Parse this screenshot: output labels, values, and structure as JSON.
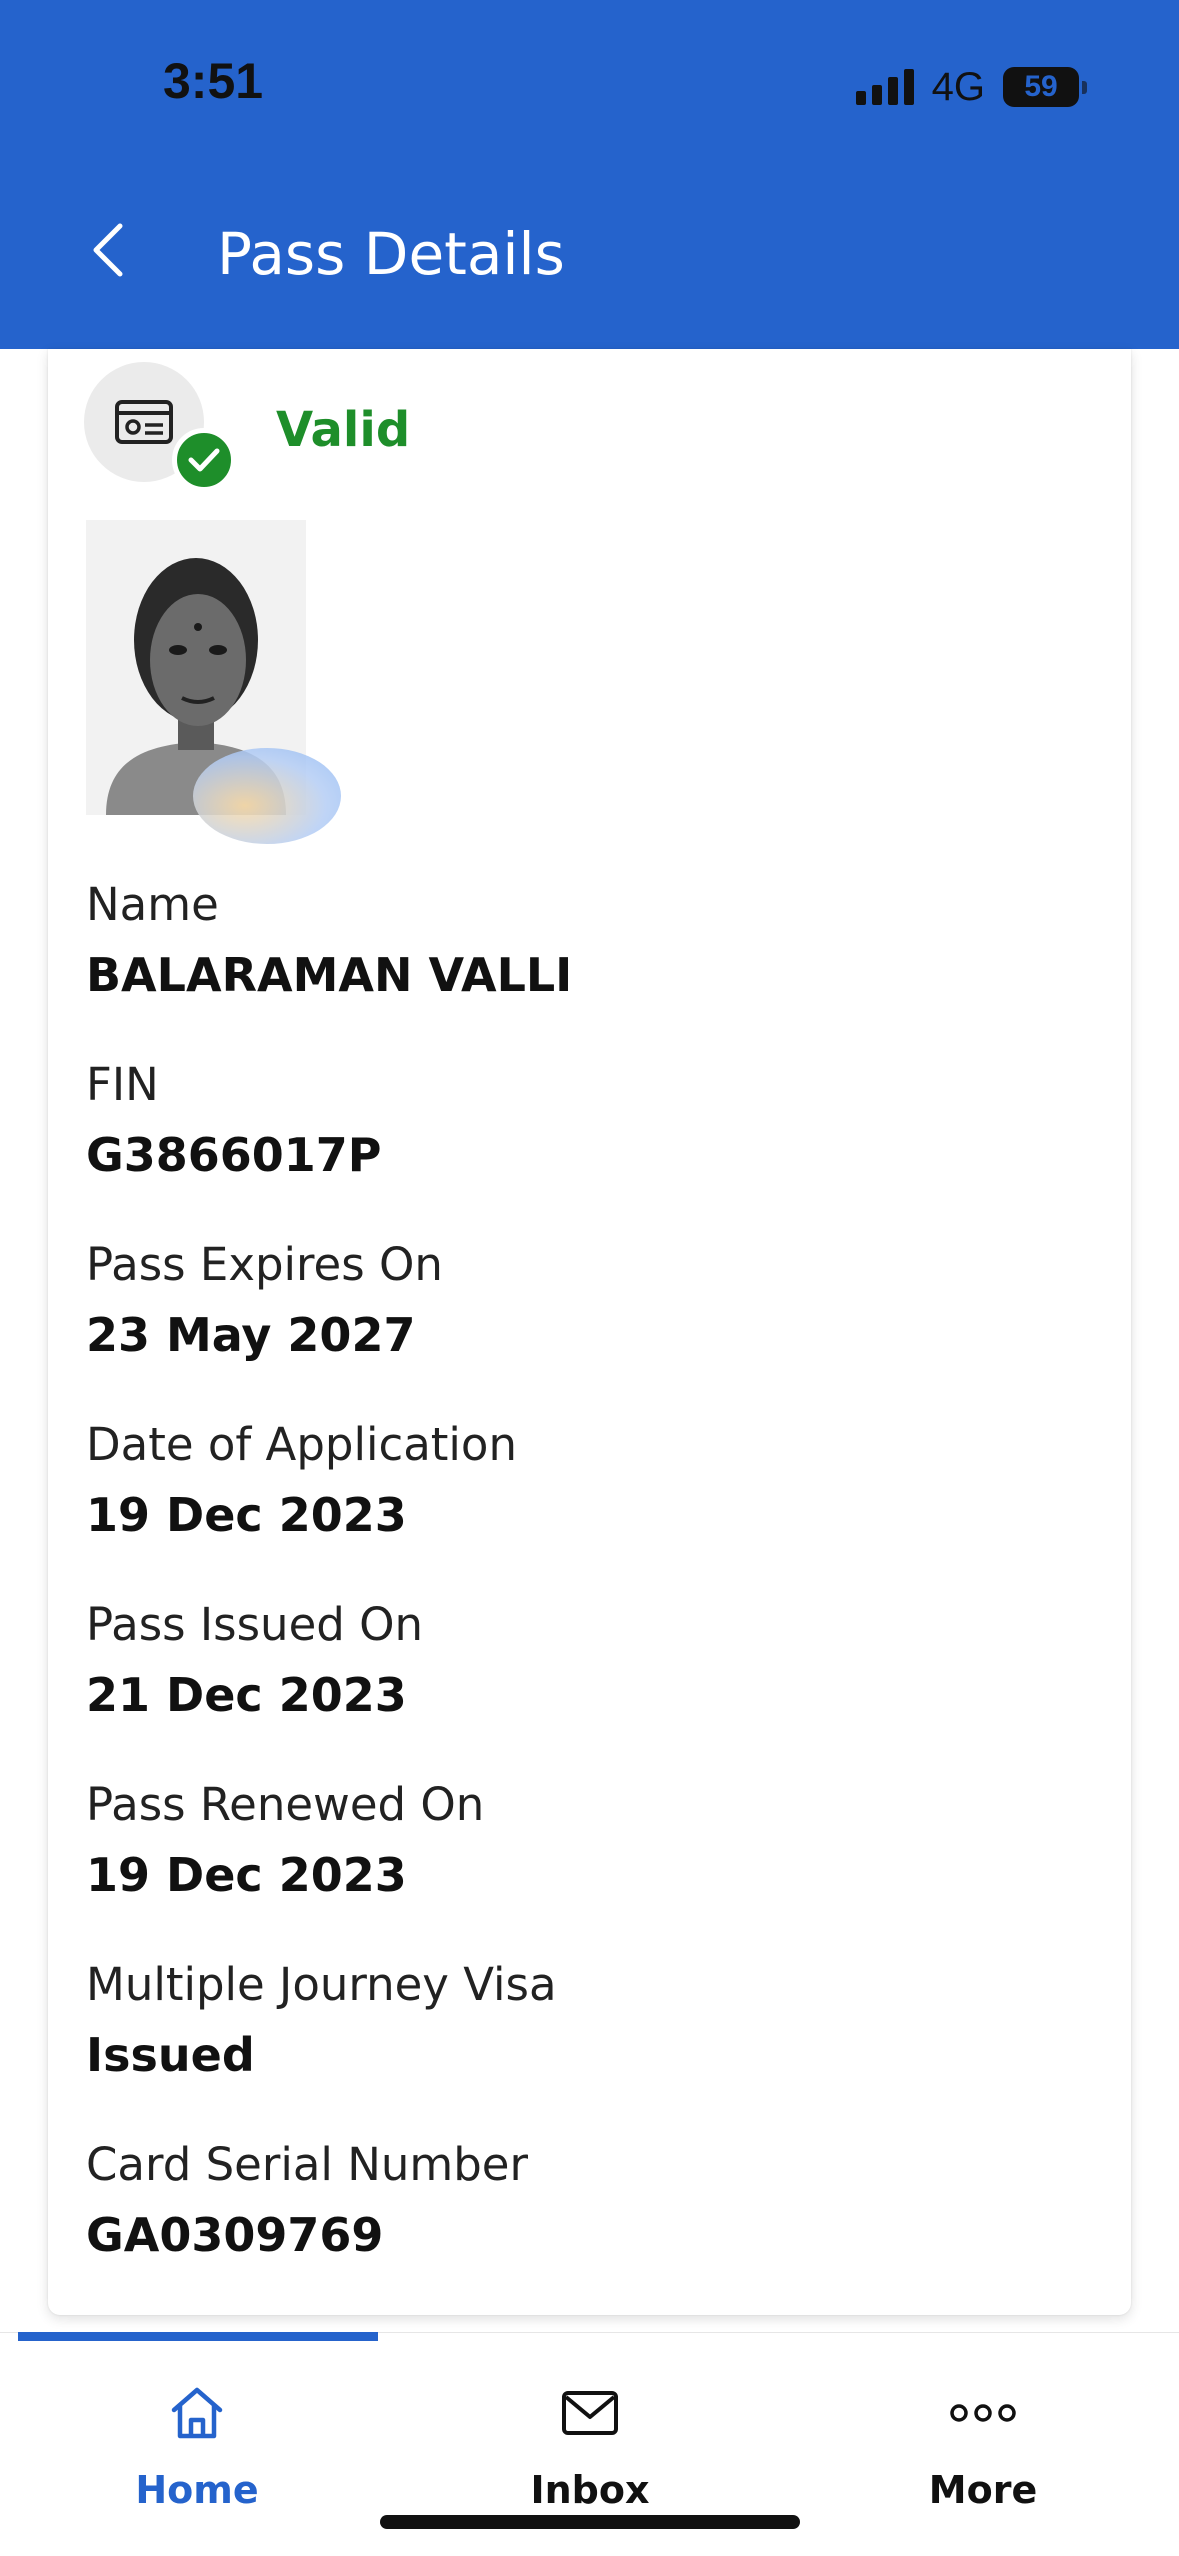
{
  "status_bar": {
    "time": "3:51",
    "network": "4G",
    "battery": "59"
  },
  "header": {
    "title": "Pass Details",
    "back_icon": "chevron-left-icon",
    "background_color": "#2563cc"
  },
  "pass": {
    "status": "Valid",
    "status_color": "#1e8e2a",
    "card_icon": "id-card-icon",
    "badge_icon": "check-icon"
  },
  "fields": [
    {
      "label": "Name",
      "value": "BALARAMAN VALLI"
    },
    {
      "label": "FIN",
      "value": "G3866017P"
    },
    {
      "label": "Pass Expires On",
      "value": "23 May 2027"
    },
    {
      "label": "Date of Application",
      "value": "19 Dec 2023"
    },
    {
      "label": "Pass Issued On",
      "value": "21 Dec 2023"
    },
    {
      "label": "Pass Renewed On",
      "value": "19 Dec 2023"
    },
    {
      "label": "Multiple Journey Visa",
      "value": "Issued"
    },
    {
      "label": "Card Serial Number",
      "value": "GA0309769"
    }
  ],
  "tabbar": {
    "tabs": [
      {
        "label": "Home",
        "icon": "home-icon",
        "active": true,
        "color": "#2563cc"
      },
      {
        "label": "Inbox",
        "icon": "mail-icon",
        "active": false,
        "color": "#111111"
      },
      {
        "label": "More",
        "icon": "more-icon",
        "active": false,
        "color": "#111111"
      }
    ]
  }
}
